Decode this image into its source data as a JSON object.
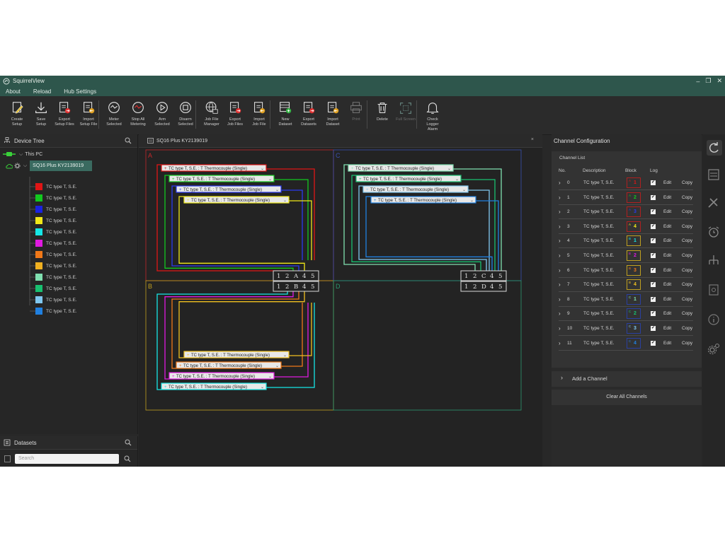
{
  "app": {
    "title": "SquirrelView"
  },
  "window": {
    "min": "–",
    "restore": "❐",
    "close": "✕"
  },
  "menu": {
    "about": "About",
    "reload": "Reload",
    "hub_settings": "Hub Settings"
  },
  "toolbar": {
    "create_setup": [
      "Create",
      "Setup"
    ],
    "save_setup": [
      "Save",
      "Setup"
    ],
    "export_setup_files": [
      "Export",
      "Setup Files"
    ],
    "import_setup_file": [
      "Import",
      "Setup File"
    ],
    "meter_selected": [
      "Meter",
      "Selected"
    ],
    "stop_all_metering": [
      "Stop All",
      "Metering"
    ],
    "arm_selected": [
      "Arm",
      "Selected"
    ],
    "disarm_selected": [
      "Disarm",
      "Selected"
    ],
    "job_file_manager": [
      "Job File",
      "Manager"
    ],
    "export_job_files": [
      "Export",
      "Job Files"
    ],
    "import_job_file": [
      "Import",
      "Job File"
    ],
    "new_dataset": [
      "New",
      "Dataset"
    ],
    "export_datasets": [
      "Export",
      "Datasets"
    ],
    "import_dataset": [
      "Import",
      "Dataset"
    ],
    "print": [
      "Print"
    ],
    "delete": [
      "Delete"
    ],
    "full_screen": [
      "Full Screen"
    ],
    "check_logger_alarm": [
      "Check",
      "Logger",
      "Alarm"
    ]
  },
  "device_tree": {
    "title": "Device Tree",
    "this_pc": "This PC",
    "logger": "SQ16 Plus KY2139019",
    "channels": [
      {
        "label": "TC type T, S.E.",
        "color": "#e01515"
      },
      {
        "label": "TC type T, S.E.",
        "color": "#12c81e"
      },
      {
        "label": "TC type T, S.E.",
        "color": "#1a22e0"
      },
      {
        "label": "TC type T, S.E.",
        "color": "#f0e818"
      },
      {
        "label": "TC type T, S.E.",
        "color": "#16e6e6"
      },
      {
        "label": "TC type T, S.E.",
        "color": "#e01ae0"
      },
      {
        "label": "TC type T, S.E.",
        "color": "#f07818"
      },
      {
        "label": "TC type T, S.E.",
        "color": "#f0b020"
      },
      {
        "label": "TC type T, S.E.",
        "color": "#80e0b0"
      },
      {
        "label": "TC type T, S.E.",
        "color": "#18c070"
      },
      {
        "label": "TC type T, S.E.",
        "color": "#80c8f0"
      },
      {
        "label": "TC type T, S.E.",
        "color": "#2080e0"
      }
    ]
  },
  "datasets": {
    "title": "Datasets",
    "search_placeholder": "Search"
  },
  "center": {
    "tab_title": "SQ16 Plus KY2139019",
    "tab_close": "×",
    "quadrants": [
      "A",
      "B",
      "C",
      "D"
    ],
    "sensor_label": "TC type T, S.E. : T Thermocouple (Single)",
    "terminal_blocks": [
      [
        "1",
        "2",
        "A",
        "4",
        "5"
      ],
      [
        "1",
        "2",
        "B",
        "4",
        "5"
      ],
      [
        "1",
        "2",
        "C",
        "4",
        "5"
      ],
      [
        "1",
        "2",
        "D",
        "4",
        "5"
      ]
    ]
  },
  "channel_config": {
    "title": "Channel Configuration",
    "list_title": "Channel List",
    "headers": {
      "no": "No.",
      "description": "Description",
      "block": "Block",
      "log": "Log"
    },
    "rows": [
      {
        "no": "0",
        "desc": "TC type T, S.E.",
        "block": "A",
        "num": "1",
        "color": "#e01515"
      },
      {
        "no": "1",
        "desc": "TC type T, S.E.",
        "block": "A",
        "num": "2",
        "color": "#12c81e"
      },
      {
        "no": "2",
        "desc": "TC type T, S.E.",
        "block": "A",
        "num": "3",
        "color": "#2a3af0"
      },
      {
        "no": "3",
        "desc": "TC type T, S.E.",
        "block": "A",
        "num": "4",
        "color": "#f0e818"
      },
      {
        "no": "4",
        "desc": "TC type T, S.E.",
        "block": "B",
        "num": "1",
        "color": "#16e6e6"
      },
      {
        "no": "5",
        "desc": "TC type T, S.E.",
        "block": "B",
        "num": "2",
        "color": "#e01ae0"
      },
      {
        "no": "6",
        "desc": "TC type T, S.E.",
        "block": "B",
        "num": "3",
        "color": "#f07818"
      },
      {
        "no": "7",
        "desc": "TC type T, S.E.",
        "block": "B",
        "num": "4",
        "color": "#f0c020"
      },
      {
        "no": "8",
        "desc": "TC type T, S.E.",
        "block": "C",
        "num": "1",
        "color": "#80e0b0"
      },
      {
        "no": "9",
        "desc": "TC type T, S.E.",
        "block": "C",
        "num": "2",
        "color": "#18c070"
      },
      {
        "no": "10",
        "desc": "TC type T, S.E.",
        "block": "C",
        "num": "3",
        "color": "#80c8f0"
      },
      {
        "no": "11",
        "desc": "TC type T, S.E.",
        "block": "C",
        "num": "4",
        "color": "#2080e0"
      }
    ],
    "check": "✔",
    "edit": "Edit",
    "copy": "Copy",
    "add_channel": "Add a Channel",
    "clear_all": "Clear All Channels"
  },
  "colors": {
    "titlebar": "#2e564c",
    "panel": "#262626",
    "accent": "#3a7a6a"
  }
}
